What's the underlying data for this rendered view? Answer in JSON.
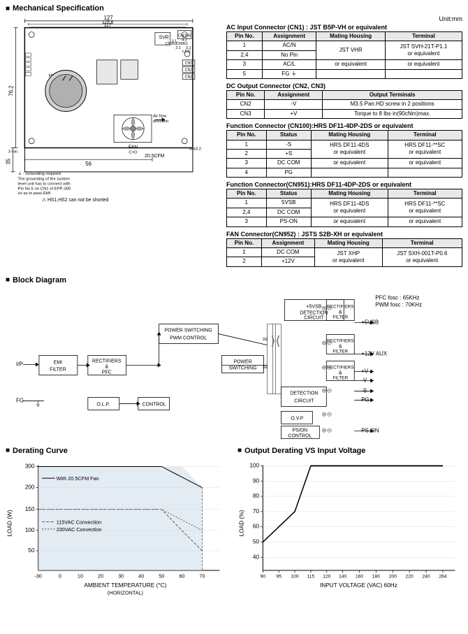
{
  "sections": {
    "mechanical": "Mechanical Specification",
    "block": "Block Diagram",
    "derating": "Derating Curve",
    "output_derating": "Output Derating VS Input Voltage"
  },
  "unit": "Unit:mm",
  "connectors": {
    "cn1": {
      "title": "AC Input Connector (CN1) : JST B5P-VH or equivalent",
      "headers": [
        "Pin No.",
        "Assignment",
        "Mating Housing",
        "Terminal"
      ],
      "rows": [
        [
          "1",
          "AC/N",
          "",
          ""
        ],
        [
          "2,4",
          "No Pin",
          "JST VHR",
          "JST SVH-21T-P1.1"
        ],
        [
          "3",
          "AC/L",
          "or equivalent",
          "or equivalent"
        ],
        [
          "5",
          "FG ⏚",
          "",
          ""
        ]
      ]
    },
    "cn2cn3": {
      "title": "DC Output Connector (CN2, CN3)",
      "headers": [
        "Pin No.",
        "Assignment",
        "Output Terminals"
      ],
      "rows": [
        [
          "CN2",
          "-V",
          "M3.5 Pan.HD screw in 2 positions"
        ],
        [
          "CN3",
          "+V",
          "Torque to 8 lbs·in(90cNm)max."
        ]
      ]
    },
    "cn100": {
      "title": "Function Connector (CN100):HRS DF11-4DP-2DS or equivalent",
      "headers": [
        "Pin No.",
        "Status",
        "Mating Housing",
        "Terminal"
      ],
      "rows": [
        [
          "1",
          "-S",
          "",
          ""
        ],
        [
          "2",
          "+S",
          "HRS DF11-4DS",
          "HRS DF11-**SC"
        ],
        [
          "3",
          "DC COM",
          "or equivalent",
          "or equivalent"
        ],
        [
          "4",
          "PG",
          "",
          ""
        ]
      ]
    },
    "cn951": {
      "title": "Function Connector(CN951):HRS DF11-4DP-2DS or equivalent",
      "headers": [
        "Pin No.",
        "Status",
        "Mating Housing",
        "Terminal"
      ],
      "rows": [
        [
          "1",
          "5VSB",
          "",
          ""
        ],
        [
          "2,4",
          "DC COM",
          "HRS DF11-4DS",
          "HRS DF11-**SC"
        ],
        [
          "3",
          "PS-ON",
          "or equivalent",
          "or equivalent"
        ]
      ]
    },
    "cn952": {
      "title": "FAN Connector(CN952) : JSTS S2B-XH or equivalent",
      "headers": [
        "Pin No.",
        "Assignment",
        "Mating Housing",
        "Terminal"
      ],
      "rows": [
        [
          "1",
          "DC COM",
          "JST XHP",
          "JST SXH-001T-P0.6"
        ],
        [
          "2",
          "+12V",
          "or equivalent",
          "or equivalent"
        ]
      ]
    }
  },
  "block_notes": {
    "pfc": "PFC fosc : 65KHz",
    "pwm": "PWM fosc : 70KHz"
  },
  "derating_chart": {
    "y_label": "LOAD (W)",
    "x_label": "AMBIENT TEMPERATURE (°C)",
    "x_note": "(HORIZONTAL)",
    "y_values": [
      "300",
      "200",
      "150",
      "100",
      "50"
    ],
    "x_values": [
      "-30",
      "0",
      "10",
      "20",
      "30",
      "40",
      "50",
      "60",
      "70"
    ],
    "legend": [
      "With 20.5CFM Fan",
      "115VAC Convection",
      "230VAC Convection"
    ]
  },
  "output_derating_chart": {
    "y_label": "LOAD (%)",
    "x_label": "INPUT VOLTAGE (VAC) 60Hz",
    "y_values": [
      "100",
      "90",
      "80",
      "70",
      "60",
      "50",
      "40"
    ],
    "x_values": [
      "90",
      "95",
      "100",
      "115",
      "120",
      "140",
      "160",
      "180",
      "200",
      "220",
      "240",
      "264"
    ]
  }
}
